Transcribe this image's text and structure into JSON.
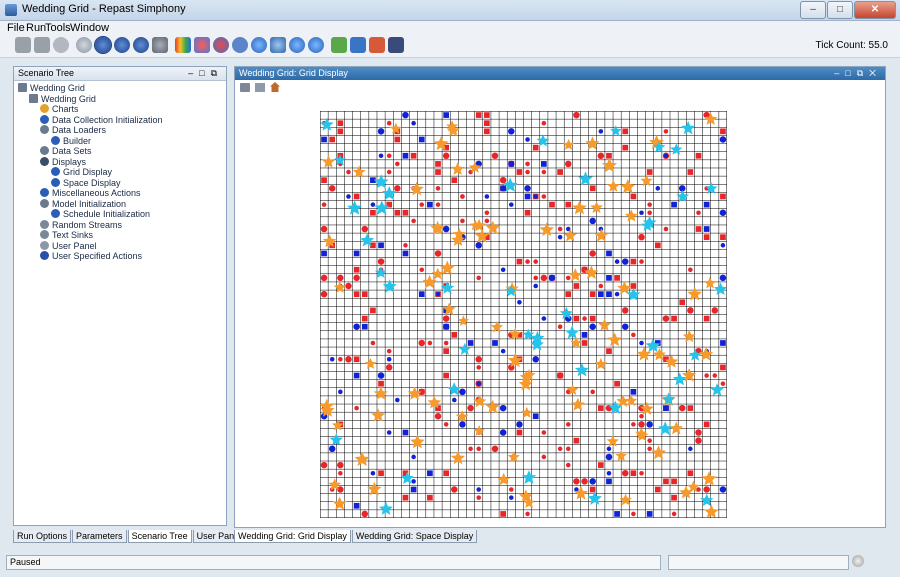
{
  "window": {
    "title": "Wedding Grid - Repast Simphony"
  },
  "menu": [
    "File",
    "Run",
    "Tools",
    "Window"
  ],
  "toolbar": {
    "icons": [
      "save-all-icon",
      "save-icon",
      "database-icon",
      "init-icon",
      "step-icon",
      "play-icon",
      "fast-play-icon",
      "stop-icon",
      "reset-icon",
      "palette-icon",
      "agents-icon",
      "chart-icon",
      "db2-icon",
      "globe-icon",
      "search-icon",
      "earth-icon",
      "earth2-icon",
      "grid-icon",
      "table-icon",
      "record-icon",
      "filmstrip-icon"
    ],
    "tick_count": "Tick Count: 55.0"
  },
  "scenario_tree": {
    "title": "Scenario Tree",
    "items": [
      {
        "label": "Wedding Grid",
        "level": 0
      },
      {
        "label": "Wedding Grid",
        "level": 1
      },
      {
        "label": "Charts",
        "level": 2
      },
      {
        "label": "Data Collection Initialization",
        "level": 2
      },
      {
        "label": "Data Loaders",
        "level": 2
      },
      {
        "label": "Builder",
        "level": 3
      },
      {
        "label": "Data Sets",
        "level": 2
      },
      {
        "label": "Displays",
        "level": 2
      },
      {
        "label": "Grid Display",
        "level": 3
      },
      {
        "label": "Space Display",
        "level": 3
      },
      {
        "label": "Miscellaneous Actions",
        "level": 2
      },
      {
        "label": "Model Initialization",
        "level": 2
      },
      {
        "label": "Schedule Initialization",
        "level": 3
      },
      {
        "label": "Random Streams",
        "level": 2
      },
      {
        "label": "Text Sinks",
        "level": 2
      },
      {
        "label": "User Panel",
        "level": 2
      },
      {
        "label": "User Specified Actions",
        "level": 2
      }
    ],
    "tabs": [
      "Run Options",
      "Parameters",
      "Scenario Tree",
      "User Panel"
    ],
    "active_tab": "Scenario Tree"
  },
  "display": {
    "title": "Wedding Grid: Grid Display",
    "tabs": [
      "Wedding Grid: Grid Display",
      "Wedding Grid: Space Display"
    ],
    "active_tab": "Wedding Grid: Grid Display",
    "colors": {
      "red": "#e8262a",
      "blue": "#1122d6",
      "orange": "#f79a2c",
      "cyan": "#26c3ea"
    },
    "grid_cells": 50,
    "agents": {
      "red_markers": 260,
      "blue_markers": 120,
      "orange_stars": 100,
      "cyan_stars": 45
    }
  },
  "status": {
    "text": "Paused"
  }
}
